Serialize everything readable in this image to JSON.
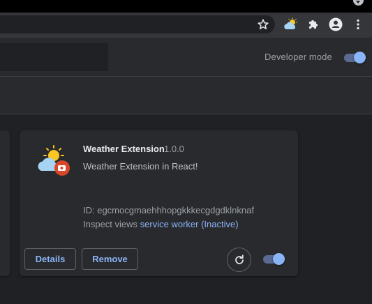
{
  "browser": {
    "icons": [
      "bookmark-star-icon",
      "weather-extension-toolbar-icon",
      "extensions-puzzle-icon",
      "profile-icon",
      "more-menu-icon"
    ]
  },
  "header": {
    "developer_mode_label": "Developer mode",
    "developer_mode_enabled": true
  },
  "extension": {
    "name": "Weather Extension",
    "version": "1.0.0",
    "description": "Weather Extension in React!",
    "id_text": "ID: egcmocgmaehhhopgkkkecgdgdklnknaf",
    "inspect_label": "Inspect views",
    "inspect_link": "service worker (Inactive)",
    "details_label": "Details",
    "remove_label": "Remove",
    "enabled": true
  },
  "colors": {
    "accent": "#8ab4f8",
    "background": "#202124",
    "card": "#292a2d"
  }
}
